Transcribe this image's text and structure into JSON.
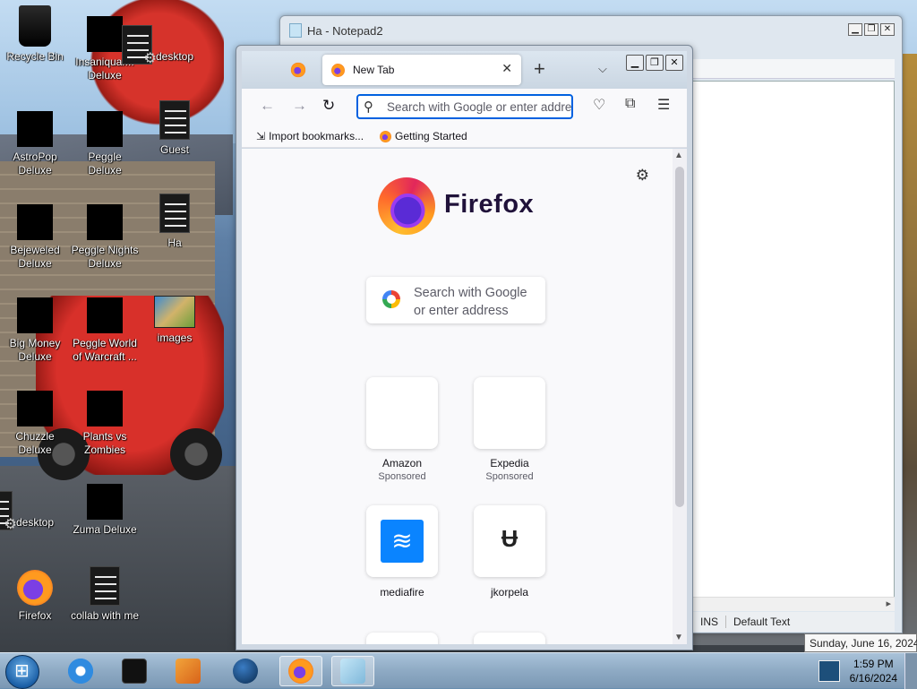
{
  "desktop": {
    "icons": [
      {
        "label": "Recycle Bin",
        "icon": "recycle-bin-icon"
      },
      {
        "label": "Insaniquar... Deluxe",
        "icon": "game-icon"
      },
      {
        "label": "desktop",
        "icon": "document-icon"
      },
      {
        "label": "AstroPop Deluxe",
        "icon": "game-icon"
      },
      {
        "label": "Peggle Deluxe",
        "icon": "game-icon"
      },
      {
        "label": "Guest",
        "icon": "document-icon"
      },
      {
        "label": "Bejeweled Deluxe",
        "icon": "game-icon"
      },
      {
        "label": "Peggle Nights Deluxe",
        "icon": "game-icon"
      },
      {
        "label": "Ha",
        "icon": "document-icon"
      },
      {
        "label": "Big Money Deluxe",
        "icon": "game-icon"
      },
      {
        "label": "Peggle World of Warcraft ...",
        "icon": "game-icon"
      },
      {
        "label": "images",
        "icon": "image-icon"
      },
      {
        "label": "Chuzzle Deluxe",
        "icon": "game-icon"
      },
      {
        "label": "Plants vs Zombies",
        "icon": "game-icon"
      },
      {
        "label": "desktop",
        "icon": "document-icon"
      },
      {
        "label": "Zuma Deluxe",
        "icon": "game-icon"
      },
      {
        "label": "Firefox",
        "icon": "firefox-icon"
      },
      {
        "label": "collab with me",
        "icon": "document-icon"
      }
    ]
  },
  "notepad": {
    "title": "Ha - Notepad2",
    "status": {
      "mode": "INS",
      "scheme": "Default Text"
    }
  },
  "firefox": {
    "tab_title": "New Tab",
    "url_placeholder": "Search with Google or enter address",
    "bookmarks": {
      "import": "Import bookmarks...",
      "getting_started": "Getting Started"
    },
    "brand": "Firefox",
    "search_box": {
      "line1": "Search with Google",
      "line2": "or enter address"
    },
    "shortcuts": [
      {
        "label": "Amazon",
        "sponsored": "Sponsored"
      },
      {
        "label": "Expedia",
        "sponsored": "Sponsored"
      },
      {
        "label": "mediafire",
        "sponsored": ""
      },
      {
        "label": "jkorpela",
        "sponsored": ""
      }
    ]
  },
  "taskbar": {
    "time": "1:59 PM",
    "date": "6/16/2024",
    "tooltip": "Sunday, June 16, 2024"
  }
}
